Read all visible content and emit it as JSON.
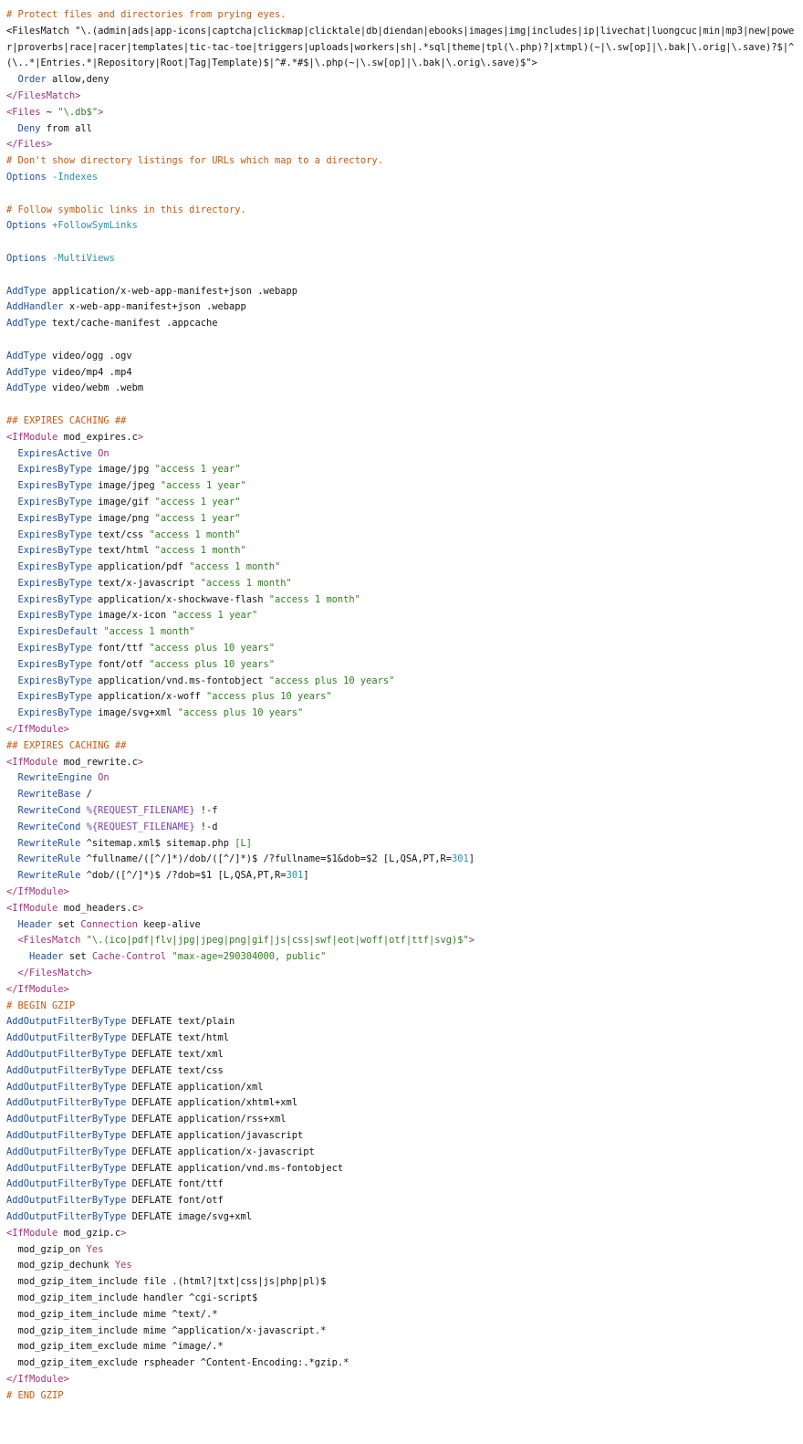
{
  "colors": {
    "background": "#ffffff",
    "comment": "#c8580e",
    "tag": "#a0307a",
    "directive": "#1f4fa0",
    "string": "#2e7d1e",
    "number": "#2a8fa8",
    "text": "#111111"
  },
  "lines": [
    [
      [
        "c",
        "# Protect files and directories from prying eyes."
      ]
    ],
    [
      [
        "p",
        "<FilesMatch \"\\.(admin|ads|app-icons|captcha|clickmap|clicktale|db|diendan|ebooks|images|img|includes|ip|livechat|luongcuc|min|mp3|new|power|proverbs|race|racer|templates|tic-tac-toe|triggers|uploads|workers|sh|.*sql|theme|tpl(\\.php)?|xtmpl)(~|\\.sw[op]|\\.bak|\\.orig|\\.save)?$|^(\\..*|Entries.*|Repository|Root|Tag|Template)$|^#.*#$|\\.php(~|\\.sw[op]|\\.bak|\\.orig\\.save)$\">"
      ]
    ],
    [
      [
        "p",
        "  "
      ],
      [
        "d",
        "Order"
      ],
      [
        "p",
        " allow,deny"
      ]
    ],
    [
      [
        "t",
        "</FilesMatch>"
      ]
    ],
    [
      [
        "t",
        "<Files"
      ],
      [
        "p",
        " ~ "
      ],
      [
        "s",
        "\"\\.db$\""
      ],
      [
        "t",
        ">"
      ]
    ],
    [
      [
        "p",
        "  "
      ],
      [
        "d",
        "Deny"
      ],
      [
        "p",
        " from all"
      ]
    ],
    [
      [
        "t",
        "</Files>"
      ]
    ],
    [
      [
        "c",
        "# Don't show directory listings for URLs which map to a directory."
      ]
    ],
    [
      [
        "d",
        "Options"
      ],
      [
        "p",
        " "
      ],
      [
        "n",
        "-Indexes"
      ]
    ],
    [
      [
        "p",
        ""
      ]
    ],
    [
      [
        "c",
        "# Follow symbolic links in this directory."
      ]
    ],
    [
      [
        "d",
        "Options"
      ],
      [
        "p",
        " "
      ],
      [
        "n",
        "+FollowSymLinks"
      ]
    ],
    [
      [
        "p",
        ""
      ]
    ],
    [
      [
        "d",
        "Options"
      ],
      [
        "p",
        " "
      ],
      [
        "n",
        "-MultiViews"
      ]
    ],
    [
      [
        "p",
        ""
      ]
    ],
    [
      [
        "d",
        "AddType"
      ],
      [
        "p",
        " application/x-web-app-manifest+json .webapp"
      ]
    ],
    [
      [
        "d",
        "AddHandler"
      ],
      [
        "p",
        " x-web-app-manifest+json .webapp"
      ]
    ],
    [
      [
        "d",
        "AddType"
      ],
      [
        "p",
        " text/cache-manifest .appcache"
      ]
    ],
    [
      [
        "p",
        ""
      ]
    ],
    [
      [
        "d",
        "AddType"
      ],
      [
        "p",
        " video/ogg .ogv"
      ]
    ],
    [
      [
        "d",
        "AddType"
      ],
      [
        "p",
        " video/mp4 .mp4"
      ]
    ],
    [
      [
        "d",
        "AddType"
      ],
      [
        "p",
        " video/webm .webm"
      ]
    ],
    [
      [
        "p",
        ""
      ]
    ],
    [
      [
        "c",
        "## EXPIRES CACHING ##"
      ]
    ],
    [
      [
        "t",
        "<IfModule"
      ],
      [
        "p",
        " mod_expires.c"
      ],
      [
        "t",
        ">"
      ]
    ],
    [
      [
        "p",
        "  "
      ],
      [
        "d",
        "ExpiresActive"
      ],
      [
        "p",
        " "
      ],
      [
        "t",
        "On"
      ]
    ],
    [
      [
        "p",
        "  "
      ],
      [
        "d",
        "ExpiresByType"
      ],
      [
        "p",
        " image/jpg "
      ],
      [
        "s",
        "\"access 1 year\""
      ]
    ],
    [
      [
        "p",
        "  "
      ],
      [
        "d",
        "ExpiresByType"
      ],
      [
        "p",
        " image/jpeg "
      ],
      [
        "s",
        "\"access 1 year\""
      ]
    ],
    [
      [
        "p",
        "  "
      ],
      [
        "d",
        "ExpiresByType"
      ],
      [
        "p",
        " image/gif "
      ],
      [
        "s",
        "\"access 1 year\""
      ]
    ],
    [
      [
        "p",
        "  "
      ],
      [
        "d",
        "ExpiresByType"
      ],
      [
        "p",
        " image/png "
      ],
      [
        "s",
        "\"access 1 year\""
      ]
    ],
    [
      [
        "p",
        "  "
      ],
      [
        "d",
        "ExpiresByType"
      ],
      [
        "p",
        " text/css "
      ],
      [
        "s",
        "\"access 1 month\""
      ]
    ],
    [
      [
        "p",
        "  "
      ],
      [
        "d",
        "ExpiresByType"
      ],
      [
        "p",
        " text/html "
      ],
      [
        "s",
        "\"access 1 month\""
      ]
    ],
    [
      [
        "p",
        "  "
      ],
      [
        "d",
        "ExpiresByType"
      ],
      [
        "p",
        " application/pdf "
      ],
      [
        "s",
        "\"access 1 month\""
      ]
    ],
    [
      [
        "p",
        "  "
      ],
      [
        "d",
        "ExpiresByType"
      ],
      [
        "p",
        " text/x-javascript "
      ],
      [
        "s",
        "\"access 1 month\""
      ]
    ],
    [
      [
        "p",
        "  "
      ],
      [
        "d",
        "ExpiresByType"
      ],
      [
        "p",
        " application/x-shockwave-flash "
      ],
      [
        "s",
        "\"access 1 month\""
      ]
    ],
    [
      [
        "p",
        "  "
      ],
      [
        "d",
        "ExpiresByType"
      ],
      [
        "p",
        " image/x-icon "
      ],
      [
        "s",
        "\"access 1 year\""
      ]
    ],
    [
      [
        "p",
        "  "
      ],
      [
        "d",
        "ExpiresDefault"
      ],
      [
        "p",
        " "
      ],
      [
        "s",
        "\"access 1 month\""
      ]
    ],
    [
      [
        "p",
        "  "
      ],
      [
        "d",
        "ExpiresByType"
      ],
      [
        "p",
        " font/ttf "
      ],
      [
        "s",
        "\"access plus 10 years\""
      ]
    ],
    [
      [
        "p",
        "  "
      ],
      [
        "d",
        "ExpiresByType"
      ],
      [
        "p",
        " font/otf "
      ],
      [
        "s",
        "\"access plus 10 years\""
      ]
    ],
    [
      [
        "p",
        "  "
      ],
      [
        "d",
        "ExpiresByType"
      ],
      [
        "p",
        " application/vnd.ms-fontobject "
      ],
      [
        "s",
        "\"access plus 10 years\""
      ]
    ],
    [
      [
        "p",
        "  "
      ],
      [
        "d",
        "ExpiresByType"
      ],
      [
        "p",
        " application/x-woff "
      ],
      [
        "s",
        "\"access plus 10 years\""
      ]
    ],
    [
      [
        "p",
        "  "
      ],
      [
        "d",
        "ExpiresByType"
      ],
      [
        "p",
        " image/svg+xml "
      ],
      [
        "s",
        "\"access plus 10 years\""
      ]
    ],
    [
      [
        "t",
        "</IfModule>"
      ]
    ],
    [
      [
        "c",
        "## EXPIRES CACHING ##"
      ]
    ],
    [
      [
        "t",
        "<IfModule"
      ],
      [
        "p",
        " mod_rewrite.c"
      ],
      [
        "t",
        ">"
      ]
    ],
    [
      [
        "p",
        "  "
      ],
      [
        "d",
        "RewriteEngine"
      ],
      [
        "p",
        " "
      ],
      [
        "t",
        "On"
      ]
    ],
    [
      [
        "p",
        "  "
      ],
      [
        "d",
        "RewriteBase"
      ],
      [
        "p",
        " /"
      ]
    ],
    [
      [
        "p",
        "  "
      ],
      [
        "d",
        "RewriteCond"
      ],
      [
        "p",
        " "
      ],
      [
        "v",
        "%{REQUEST_FILENAME}"
      ],
      [
        "p",
        " !-f"
      ]
    ],
    [
      [
        "p",
        "  "
      ],
      [
        "d",
        "RewriteCond"
      ],
      [
        "p",
        " "
      ],
      [
        "v",
        "%{REQUEST_FILENAME}"
      ],
      [
        "p",
        " !-d"
      ]
    ],
    [
      [
        "p",
        "  "
      ],
      [
        "d",
        "RewriteRule"
      ],
      [
        "p",
        " ^sitemap.xml$ sitemap.php "
      ],
      [
        "s",
        "[L]"
      ]
    ],
    [
      [
        "p",
        "  "
      ],
      [
        "d",
        "RewriteRule"
      ],
      [
        "p",
        " ^fullname/([^/]*)/dob/([^/]*)$ /?fullname=$1&dob=$2 [L,QSA,PT,R="
      ],
      [
        "n",
        "301"
      ],
      [
        "p",
        "]"
      ]
    ],
    [
      [
        "p",
        "  "
      ],
      [
        "d",
        "RewriteRule"
      ],
      [
        "p",
        " ^dob/([^/]*)$ /?dob=$1 [L,QSA,PT,R="
      ],
      [
        "n",
        "301"
      ],
      [
        "p",
        "]"
      ]
    ],
    [
      [
        "t",
        "</IfModule>"
      ]
    ],
    [
      [
        "t",
        "<IfModule"
      ],
      [
        "p",
        " mod_headers.c"
      ],
      [
        "t",
        ">"
      ]
    ],
    [
      [
        "p",
        "  "
      ],
      [
        "d",
        "Header"
      ],
      [
        "p",
        " set "
      ],
      [
        "t",
        "Connection"
      ],
      [
        "p",
        " keep-alive"
      ]
    ],
    [
      [
        "p",
        "  "
      ],
      [
        "t",
        "<FilesMatch"
      ],
      [
        "p",
        " "
      ],
      [
        "s",
        "\"\\.(ico|pdf|flv|jpg|jpeg|png|gif|js|css|swf|eot|woff|otf|ttf|svg)$\""
      ],
      [
        "t",
        ">"
      ]
    ],
    [
      [
        "p",
        "    "
      ],
      [
        "d",
        "Header"
      ],
      [
        "p",
        " set "
      ],
      [
        "t",
        "Cache-Control"
      ],
      [
        "p",
        " "
      ],
      [
        "s",
        "\"max-age=290304000, public\""
      ]
    ],
    [
      [
        "p",
        "  "
      ],
      [
        "t",
        "</FilesMatch>"
      ]
    ],
    [
      [
        "t",
        "</IfModule>"
      ]
    ],
    [
      [
        "c",
        "# BEGIN GZIP"
      ]
    ],
    [
      [
        "d",
        "AddOutputFilterByType"
      ],
      [
        "p",
        " DEFLATE text/plain"
      ]
    ],
    [
      [
        "d",
        "AddOutputFilterByType"
      ],
      [
        "p",
        " DEFLATE text/html"
      ]
    ],
    [
      [
        "d",
        "AddOutputFilterByType"
      ],
      [
        "p",
        " DEFLATE text/xml"
      ]
    ],
    [
      [
        "d",
        "AddOutputFilterByType"
      ],
      [
        "p",
        " DEFLATE text/css"
      ]
    ],
    [
      [
        "d",
        "AddOutputFilterByType"
      ],
      [
        "p",
        " DEFLATE application/xml"
      ]
    ],
    [
      [
        "d",
        "AddOutputFilterByType"
      ],
      [
        "p",
        " DEFLATE application/xhtml+xml"
      ]
    ],
    [
      [
        "d",
        "AddOutputFilterByType"
      ],
      [
        "p",
        " DEFLATE application/rss+xml"
      ]
    ],
    [
      [
        "d",
        "AddOutputFilterByType"
      ],
      [
        "p",
        " DEFLATE application/javascript"
      ]
    ],
    [
      [
        "d",
        "AddOutputFilterByType"
      ],
      [
        "p",
        " DEFLATE application/x-javascript"
      ]
    ],
    [
      [
        "d",
        "AddOutputFilterByType"
      ],
      [
        "p",
        " DEFLATE application/vnd.ms-fontobject"
      ]
    ],
    [
      [
        "d",
        "AddOutputFilterByType"
      ],
      [
        "p",
        " DEFLATE font/ttf"
      ]
    ],
    [
      [
        "d",
        "AddOutputFilterByType"
      ],
      [
        "p",
        " DEFLATE font/otf"
      ]
    ],
    [
      [
        "d",
        "AddOutputFilterByType"
      ],
      [
        "p",
        " DEFLATE image/svg+xml"
      ]
    ],
    [
      [
        "t",
        "<IfModule"
      ],
      [
        "p",
        " mod_gzip.c"
      ],
      [
        "t",
        ">"
      ]
    ],
    [
      [
        "p",
        "  mod_gzip_on "
      ],
      [
        "t",
        "Yes"
      ]
    ],
    [
      [
        "p",
        "  mod_gzip_dechunk "
      ],
      [
        "t",
        "Yes"
      ]
    ],
    [
      [
        "p",
        "  mod_gzip_item_include file .(html?|txt|css|js|php|pl)$"
      ]
    ],
    [
      [
        "p",
        "  mod_gzip_item_include handler ^cgi-script$"
      ]
    ],
    [
      [
        "p",
        "  mod_gzip_item_include mime ^text/.*"
      ]
    ],
    [
      [
        "p",
        "  mod_gzip_item_include mime ^application/x-javascript.*"
      ]
    ],
    [
      [
        "p",
        "  mod_gzip_item_exclude mime ^image/.*"
      ]
    ],
    [
      [
        "p",
        "  mod_gzip_item_exclude rspheader ^Content-Encoding:.*gzip.*"
      ]
    ],
    [
      [
        "t",
        "</IfModule>"
      ]
    ],
    [
      [
        "c",
        "# END GZIP"
      ]
    ]
  ]
}
